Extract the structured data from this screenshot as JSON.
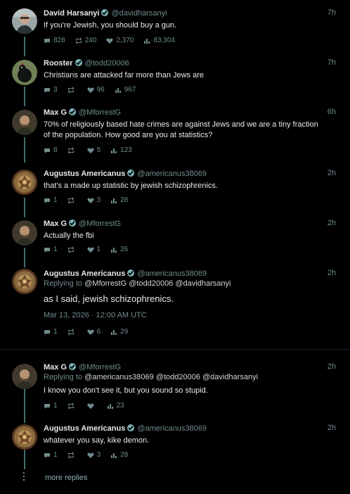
{
  "posts": [
    {
      "name": "David Harsanyi",
      "handle": "@davidharsanyi",
      "time": "7h",
      "text": "If you're Jewish, you should buy a gun.",
      "replies": "828",
      "reposts": "240",
      "likes": "2,370",
      "views": "83,304"
    },
    {
      "name": "Rooster",
      "handle": "@todd20006",
      "time": "7h",
      "text": "Christians are attacked far more than Jews are",
      "replies": "3",
      "reposts": "",
      "likes": "96",
      "views": "967"
    },
    {
      "name": "Max G",
      "handle": "@MforrestG",
      "time": "6h",
      "text": "70% of religiously based hate crimes are against Jews and we are a tiny fraction of the population. How good are you at statistics?",
      "replies": "8",
      "reposts": "",
      "likes": "5",
      "views": "123"
    },
    {
      "name": "Augustus Americanus",
      "handle": "@americanus38069",
      "time": "2h",
      "text": "that's a made up statistic by jewish schizophrenics.",
      "replies": "1",
      "reposts": "",
      "likes": "3",
      "views": "28"
    },
    {
      "name": "Max G",
      "handle": "@MforrestG",
      "time": "2h",
      "text": "Actually the fbi",
      "replies": "1",
      "reposts": "",
      "likes": "1",
      "views": "26"
    },
    {
      "name": "Augustus Americanus",
      "handle": "@americanus38069",
      "time": "2h",
      "replying_label": "Replying to",
      "replying_mentions": "@MforrestG @todd20006 @davidharsanyi",
      "text": "as I said, jewish schizophrenics.",
      "date": "Mar 13, 2026 · 12:00 AM UTC",
      "replies": "1",
      "reposts": "",
      "likes": "6",
      "views": "29"
    },
    {
      "name": "Max G",
      "handle": "@MforrestG",
      "time": "2h",
      "replying_label": "Replying to",
      "replying_mentions": "@americanus38069 @todd20006 @davidharsanyi",
      "text": "I know you don't see it, but you sound so stupid.",
      "replies": "1",
      "reposts": "",
      "likes": "",
      "views": "23"
    },
    {
      "name": "Augustus Americanus",
      "handle": "@americanus38069",
      "time": "2h",
      "text": "whatever you say, kike demon.",
      "replies": "1",
      "reposts": "",
      "likes": "3",
      "views": "28"
    }
  ],
  "more_replies": "more replies",
  "colors": {
    "background": "#000000",
    "accent": "#7fb5b8",
    "thread": "#3f6f6c",
    "muted": "#6f8b8d"
  },
  "icons": [
    "reply-icon",
    "repost-icon",
    "like-icon",
    "views-icon",
    "verified-icon"
  ]
}
